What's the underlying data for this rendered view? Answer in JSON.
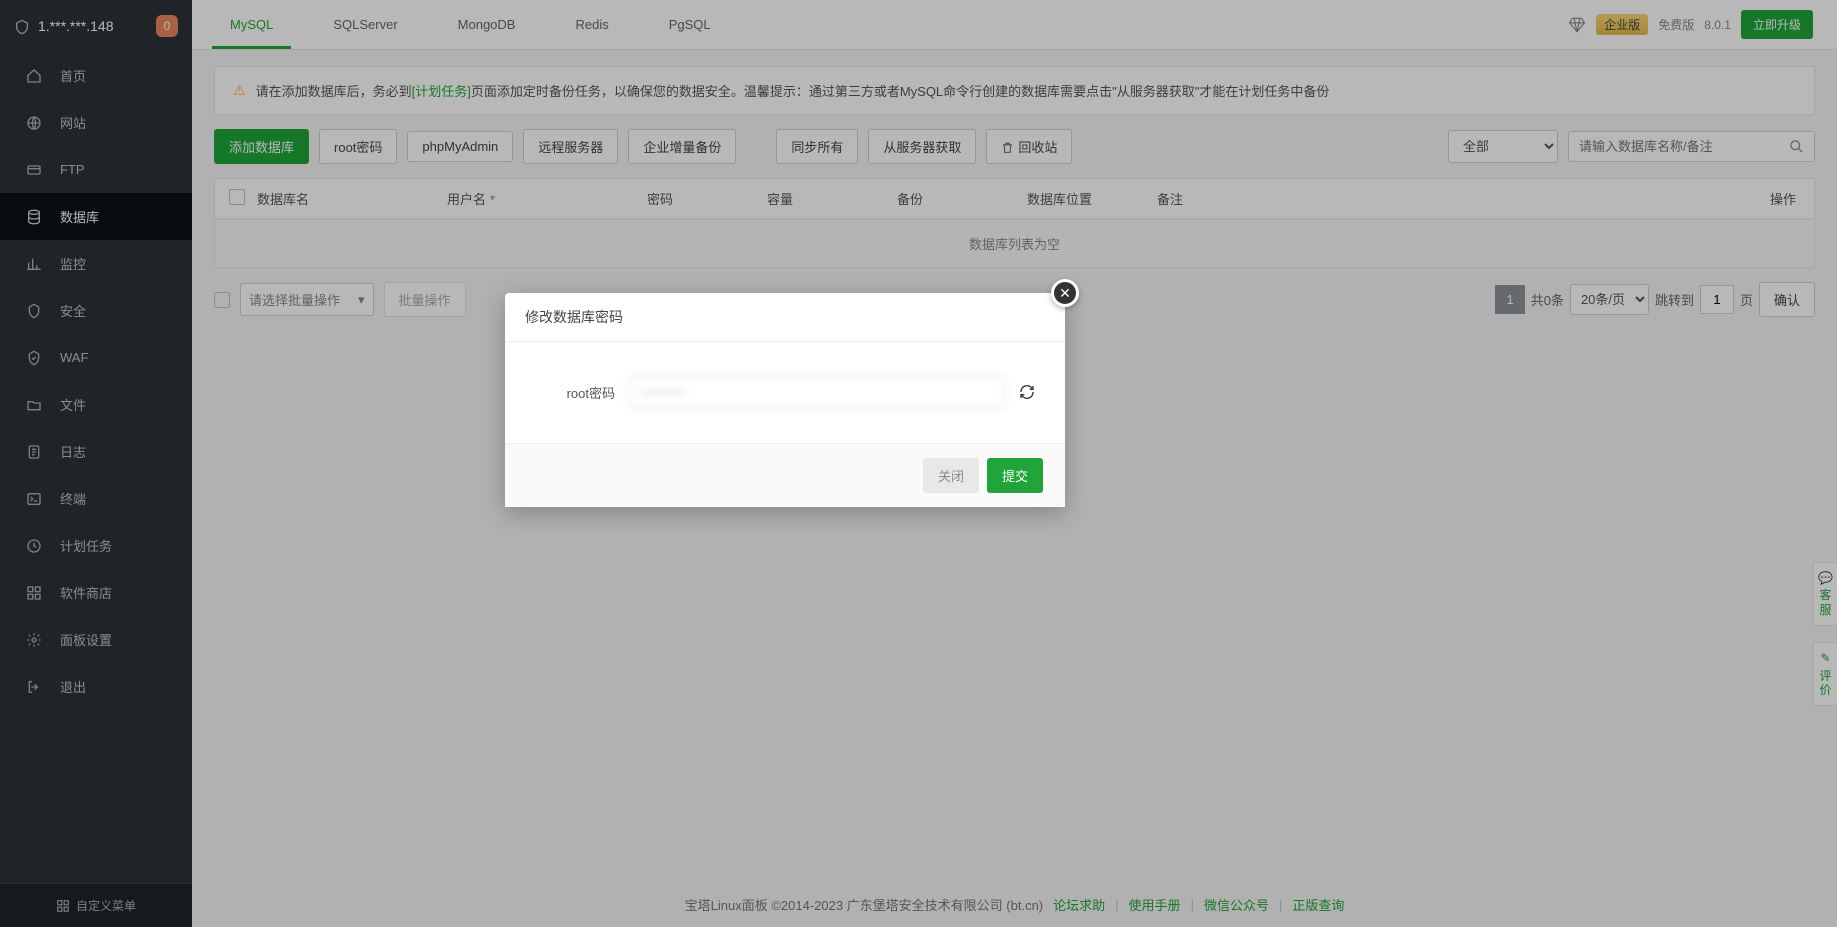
{
  "header": {
    "ip": "1.***.***.148",
    "notif_count": "0"
  },
  "sidebar": {
    "items": [
      {
        "label": "首页"
      },
      {
        "label": "网站"
      },
      {
        "label": "FTP"
      },
      {
        "label": "数据库"
      },
      {
        "label": "监控"
      },
      {
        "label": "安全"
      },
      {
        "label": "WAF"
      },
      {
        "label": "文件"
      },
      {
        "label": "日志"
      },
      {
        "label": "终端"
      },
      {
        "label": "计划任务"
      },
      {
        "label": "软件商店"
      },
      {
        "label": "面板设置"
      },
      {
        "label": "退出"
      }
    ],
    "footer_label": "自定义菜单"
  },
  "tabs": [
    "MySQL",
    "SQLServer",
    "MongoDB",
    "Redis",
    "PgSQL"
  ],
  "topbar_right": {
    "enterprise_label": "企业版",
    "free_label": "免费版",
    "version": "8.0.1",
    "upgrade_label": "立即升级"
  },
  "notice": {
    "before_link": "请在添加数据库后，务必到",
    "link_text": "[计划任务]",
    "after_link": "页面添加定时备份任务，以确保您的数据安全。温馨提示：通过第三方或者MySQL命令行创建的数据库需要点击\"从服务器获取\"才能在计划任务中备份"
  },
  "toolbar": {
    "add_db": "添加数据库",
    "root_pwd": "root密码",
    "phpmyadmin": "phpMyAdmin",
    "remote_server": "远程服务器",
    "enterprise_backup": "企业增量备份",
    "sync_all": "同步所有",
    "fetch_server": "从服务器获取",
    "recycle": "回收站",
    "filter_all": "全部",
    "search_placeholder": "请输入数据库名称/备注"
  },
  "table": {
    "headers": {
      "dbname": "数据库名",
      "user": "用户名",
      "pwd": "密码",
      "cap": "容量",
      "bak": "备份",
      "loc": "数据库位置",
      "remark": "备注",
      "act": "操作"
    },
    "empty_label": "数据库列表为空"
  },
  "batch": {
    "select_placeholder": "请选择批量操作",
    "batch_btn": "批量操作"
  },
  "pagination": {
    "total_label": "共0条",
    "per_page": "20条/页",
    "jump_label": "跳转到",
    "jump_page": "1",
    "page_unit": "页",
    "confirm": "确认",
    "current_page": "1"
  },
  "footer": {
    "copyright": "宝塔Linux面板 ©2014-2023 广东堡塔安全技术有限公司 (bt.cn)",
    "links": [
      "论坛求助",
      "使用手册",
      "微信公众号",
      "正版查询"
    ]
  },
  "side_float": {
    "kf": "客服",
    "pj": "评价"
  },
  "modal": {
    "title": "修改数据库密码",
    "label": "root密码",
    "password_value": "••••••••••",
    "close_label": "关闭",
    "submit_label": "提交"
  }
}
